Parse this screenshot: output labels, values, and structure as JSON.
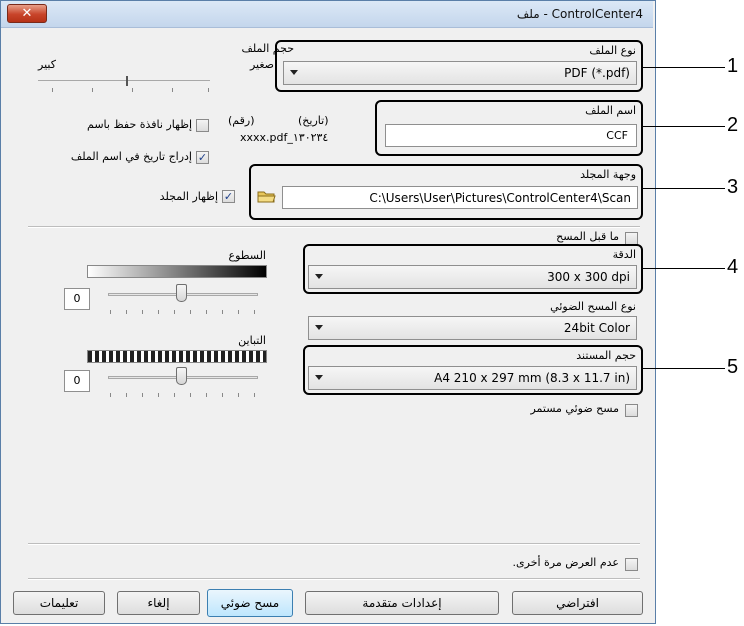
{
  "window": {
    "title": "ControlCenter4 - ملف",
    "close_label": "✕"
  },
  "file_type": {
    "label": "نوع الملف",
    "value": "PDF (*.pdf)"
  },
  "file_size": {
    "label": "حجم الملف",
    "small": "صغير",
    "large": "كبير",
    "level": 0.25
  },
  "file_name": {
    "label": "اسم الملف",
    "value": "CCF"
  },
  "show_save_as": {
    "label": "إظهار نافذة حفظ باسم",
    "checked": false
  },
  "insert_date": {
    "label": "إدراج تاريخ في اسم الملف",
    "checked": true
  },
  "name_preview": {
    "date_label": "(تاريخ)",
    "number_label": "(رقم)",
    "example": "xxxx.pdf_١٣٠٢٣٤"
  },
  "destination": {
    "label": "وجهة المجلد",
    "value": "C:\\Users\\User\\Pictures\\ControlCenter4\\Scan",
    "folder_icon": "folder-icon"
  },
  "show_folder": {
    "label": "إظهار المجلد",
    "checked": true
  },
  "prescan": {
    "label": "ما قبل المسح",
    "checked": false
  },
  "resolution": {
    "label": "الدقة",
    "value": "300 x 300 dpi"
  },
  "scan_type": {
    "label": "نوع المسح الضوئي",
    "value": "24bit Color"
  },
  "doc_size": {
    "label": "حجم المستند",
    "value": "A4 210 x 297 mm (8.3 x 11.7 in)"
  },
  "continuous": {
    "label": "مسح ضوئي مستمر",
    "checked": false
  },
  "brightness": {
    "label": "السطوع",
    "value": "0",
    "level": 0.5
  },
  "contrast": {
    "label": "التباين",
    "value": "0",
    "level": 0.5
  },
  "dont_show": {
    "label": "عدم العرض مرة أخرى.",
    "checked": false
  },
  "buttons": {
    "default": "افتراضي",
    "advanced": "إعدادات متقدمة",
    "scan": "مسح ضوئي",
    "cancel": "إلغاء",
    "help": "تعليمات"
  },
  "callouts": [
    "1",
    "2",
    "3",
    "4",
    "5"
  ]
}
